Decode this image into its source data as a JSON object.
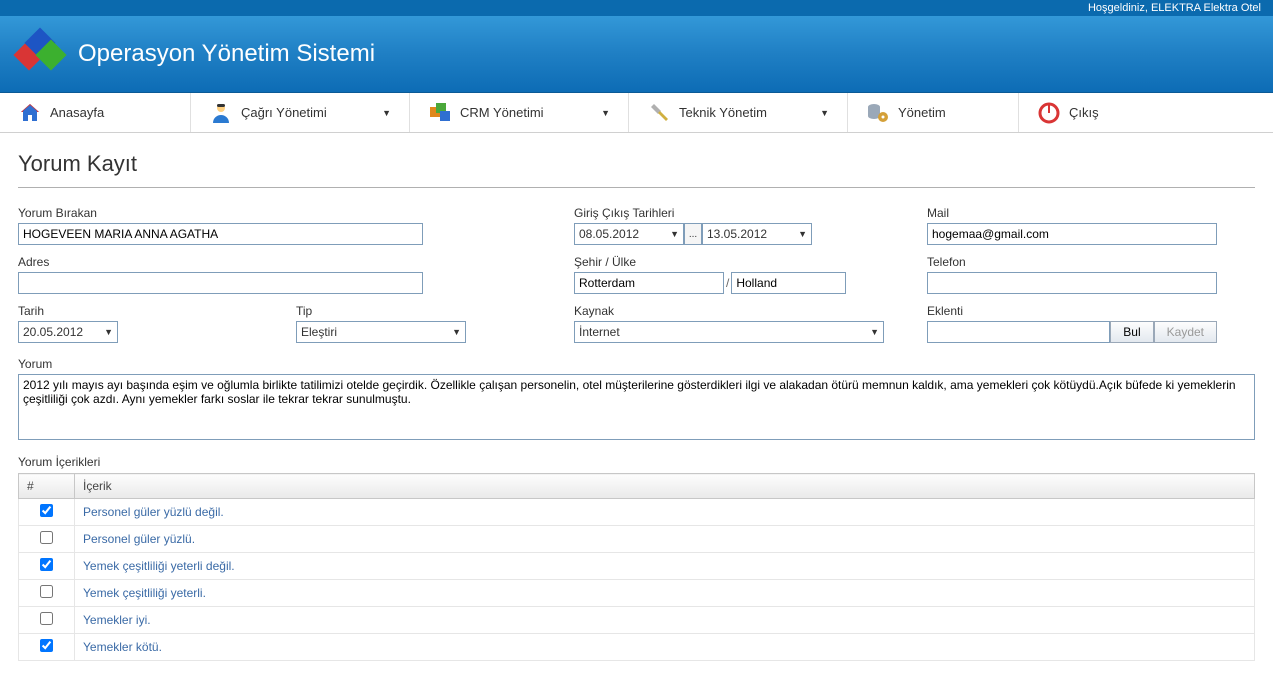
{
  "welcome": "Hoşgeldiniz, ELEKTRA Elektra Otel",
  "app_title": "Operasyon Yönetim Sistemi",
  "menu": {
    "home": "Anasayfa",
    "call": "Çağrı Yönetimi",
    "crm": "CRM Yönetimi",
    "tech": "Teknik Yönetim",
    "admin": "Yönetim",
    "exit": "Çıkış"
  },
  "page_title": "Yorum Kayıt",
  "labels": {
    "yorum_birakan": "Yorum Bırakan",
    "giris_cikis": "Giriş Çıkış Tarihleri",
    "mail": "Mail",
    "adres": "Adres",
    "sehir_ulke": "Şehir / Ülke",
    "telefon": "Telefon",
    "tarih": "Tarih",
    "tip": "Tip",
    "kaynak": "Kaynak",
    "eklenti": "Eklenti",
    "yorum": "Yorum",
    "yorum_icerikleri": "Yorum İçerikleri"
  },
  "values": {
    "yorum_birakan": "HOGEVEEN MARIA ANNA AGATHA",
    "giris": "08.05.2012",
    "cikis": "13.05.2012",
    "mail": "hogemaa@gmail.com",
    "adres": "",
    "sehir": "Rotterdam",
    "ulke": "Holland",
    "telefon": "",
    "tarih": "20.05.2012",
    "tip": "Eleştiri",
    "kaynak": "İnternet",
    "eklenti": "",
    "yorum": "2012 yılı mayıs ayı başında eşim ve oğlumla birlikte tatilimizi otelde geçirdik. Özellikle çalışan personelin, otel müşterilerine gösterdikleri ilgi ve alakadan ötürü memnun kaldık, ama yemekleri çok kötüydü.Açık büfede ki yemeklerin çeşitliliği çok azdı. Aynı yemekler farkı soslar ile tekrar tekrar sunulmuştu."
  },
  "buttons": {
    "bul": "Bul",
    "kaydet": "Kaydet",
    "date_sep": "..."
  },
  "table": {
    "col_hash": "#",
    "col_icerik": "İçerik",
    "rows": [
      {
        "checked": true,
        "text": "Personel güler yüzlü değil."
      },
      {
        "checked": false,
        "text": "Personel güler yüzlü."
      },
      {
        "checked": true,
        "text": "Yemek çeşitliliği yeterli değil."
      },
      {
        "checked": false,
        "text": "Yemek çeşitliliği yeterli."
      },
      {
        "checked": false,
        "text": "Yemekler iyi."
      },
      {
        "checked": true,
        "text": "Yemekler kötü."
      }
    ]
  }
}
